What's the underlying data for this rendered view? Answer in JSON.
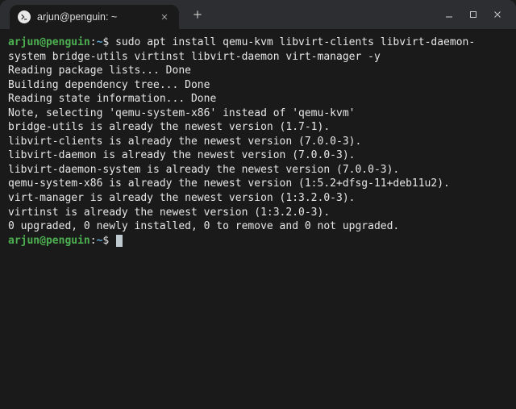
{
  "titlebar": {
    "tab_title": "arjun@penguin: ~"
  },
  "prompt": {
    "user_host": "arjun@penguin",
    "sep": ":",
    "path": "~",
    "symbol": "$"
  },
  "command": "sudo apt install qemu-kvm libvirt-clients libvirt-daemon-system bridge-utils virtinst libvirt-daemon virt-manager -y",
  "output": [
    "Reading package lists... Done",
    "Building dependency tree... Done",
    "Reading state information... Done",
    "Note, selecting 'qemu-system-x86' instead of 'qemu-kvm'",
    "bridge-utils is already the newest version (1.7-1).",
    "libvirt-clients is already the newest version (7.0.0-3).",
    "libvirt-daemon is already the newest version (7.0.0-3).",
    "libvirt-daemon-system is already the newest version (7.0.0-3).",
    "qemu-system-x86 is already the newest version (1:5.2+dfsg-11+deb11u2).",
    "virt-manager is already the newest version (1:3.2.0-3).",
    "virtinst is already the newest version (1:3.2.0-3).",
    "0 upgraded, 0 newly installed, 0 to remove and 0 not upgraded."
  ]
}
